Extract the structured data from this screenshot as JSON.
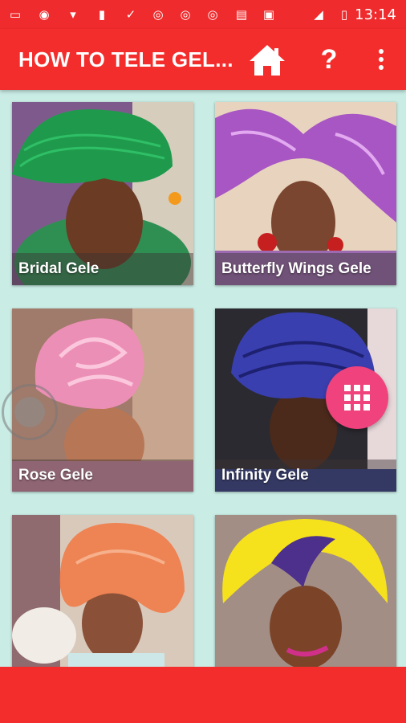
{
  "status_bar": {
    "time": "13:14",
    "icons": [
      "message-icon",
      "whatsapp-icon",
      "shirt-icon",
      "news-icon",
      "check-icon",
      "chrome-icon",
      "chrome-icon",
      "chrome-icon",
      "sms-icon",
      "p-app-icon",
      "signal-icon",
      "battery-icon"
    ]
  },
  "app_bar": {
    "title": "HOW TO TELE GEL...",
    "home_icon": "home-icon",
    "help_label": "?",
    "menu_icon": "more-vert-icon"
  },
  "grid": {
    "items": [
      {
        "caption": "Bridal Gele"
      },
      {
        "caption": "Butterfly Wings Gele"
      },
      {
        "caption": "Rose Gele"
      },
      {
        "caption": "Infinity Gele"
      },
      {
        "caption": ""
      },
      {
        "caption": ""
      }
    ]
  },
  "fab": {
    "icon": "grid-apps-icon"
  },
  "colors": {
    "primary": "#f32d2c",
    "background": "#c9ece4",
    "fab": "#f0427c"
  }
}
